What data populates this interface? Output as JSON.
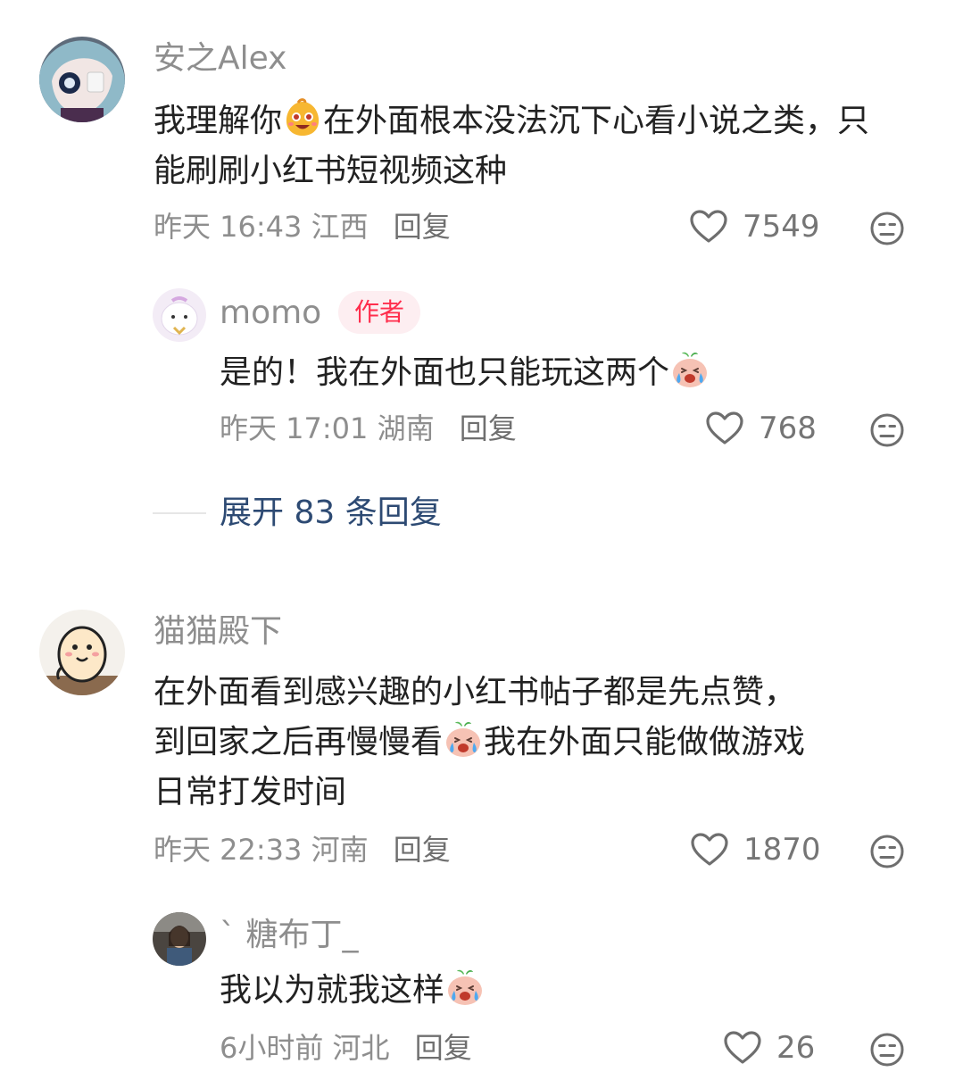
{
  "colors": {
    "name": "#8e8e8e",
    "text": "#222222",
    "author_badge_bg": "#fdeef1",
    "author_badge_text": "#ff2e4d",
    "expand_link": "#2d4a73"
  },
  "comments": [
    {
      "username": "安之Alex",
      "text_before_emoji": "我理解你",
      "emoji": "happy-face-emoji",
      "text_after_emoji": "在外面根本没法沉下心看小说之类，只能刷刷小红书短视频这种",
      "time": "昨天 16:43",
      "location": "江西",
      "reply_label": "回复",
      "likes": "7549",
      "replies": [
        {
          "username": "momo",
          "badge": "作者",
          "text": "是的！我在外面也只能玩这两个",
          "emoji": "crying-peach-emoji",
          "time": "昨天 17:01",
          "location": "湖南",
          "reply_label": "回复",
          "likes": "768"
        }
      ],
      "expand_label": "展开 83 条回复"
    },
    {
      "username": "猫猫殿下",
      "text_line1": "在外面看到感兴趣的小红书帖子都是先点赞，",
      "text_line2_before": "到回家之后再慢慢看",
      "emoji": "crying-peach-emoji",
      "text_line2_after": "我在外面只能做做游戏",
      "text_line3": "日常打发时间",
      "time": "昨天 22:33",
      "location": "河南",
      "reply_label": "回复",
      "likes": "1870",
      "replies": [
        {
          "username": "` 糖布丁_",
          "text": "我以为就我这样",
          "emoji": "crying-peach-emoji",
          "time": "6小时前",
          "location": "河北",
          "reply_label": "回复",
          "likes": "26"
        }
      ]
    }
  ]
}
